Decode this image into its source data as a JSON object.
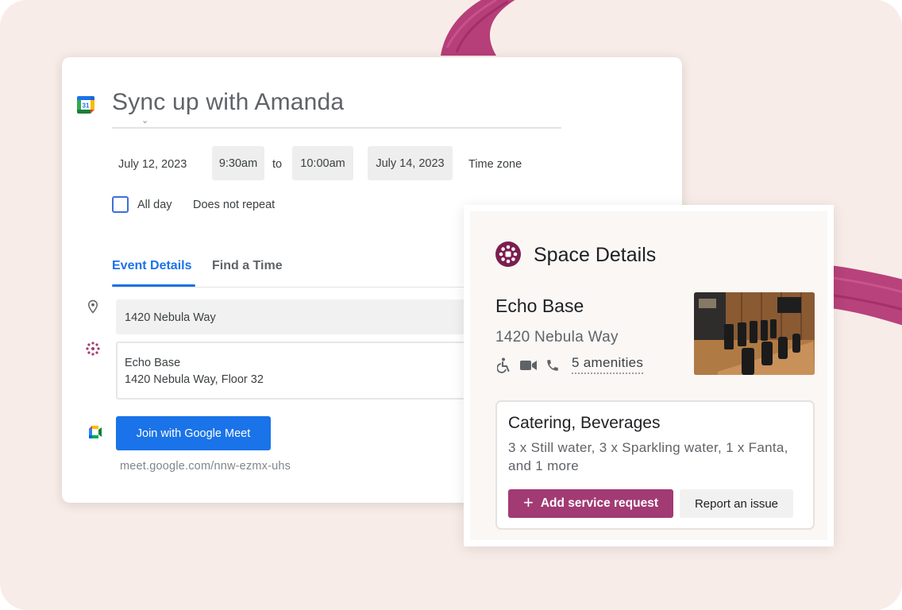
{
  "event": {
    "title": "Sync up with Amanda",
    "start_date": "July 12, 2023",
    "start_time": "9:30am",
    "to_label": "to",
    "end_time": "10:00am",
    "end_date": "July 14, 2023",
    "timezone_label": "Time zone",
    "all_day_label": "All day",
    "repeat_label": "Does not repeat",
    "tabs": [
      {
        "label": "Event Details",
        "active": true
      },
      {
        "label": "Find a Time",
        "active": false
      }
    ],
    "location": "1420 Nebula Way",
    "space_line1": "Echo Base",
    "space_line2": "1420 Nebula Way, Floor 32",
    "meet_button_label": "Join with Google Meet",
    "meet_link": "meet.google.com/nnw-ezmx-uhs"
  },
  "space_details": {
    "title": "Space Details",
    "room_name": "Echo Base",
    "room_address": "1420 Nebula Way",
    "amenities_label": "5 amenities",
    "amenity_icons": [
      "accessibility-icon",
      "video-camera-icon",
      "phone-icon"
    ],
    "catering": {
      "title": "Catering, Beverages",
      "description": "3 x Still water, 3 x Sparkling water, 1 x Fanta, and 1 more",
      "add_button_label": "Add service request",
      "report_button_label": "Report an issue"
    }
  },
  "colors": {
    "background": "#f8ece8",
    "brush_stroke": "#b0306f",
    "primary_blue": "#1a73e8",
    "accent_magenta": "#a23a74"
  }
}
